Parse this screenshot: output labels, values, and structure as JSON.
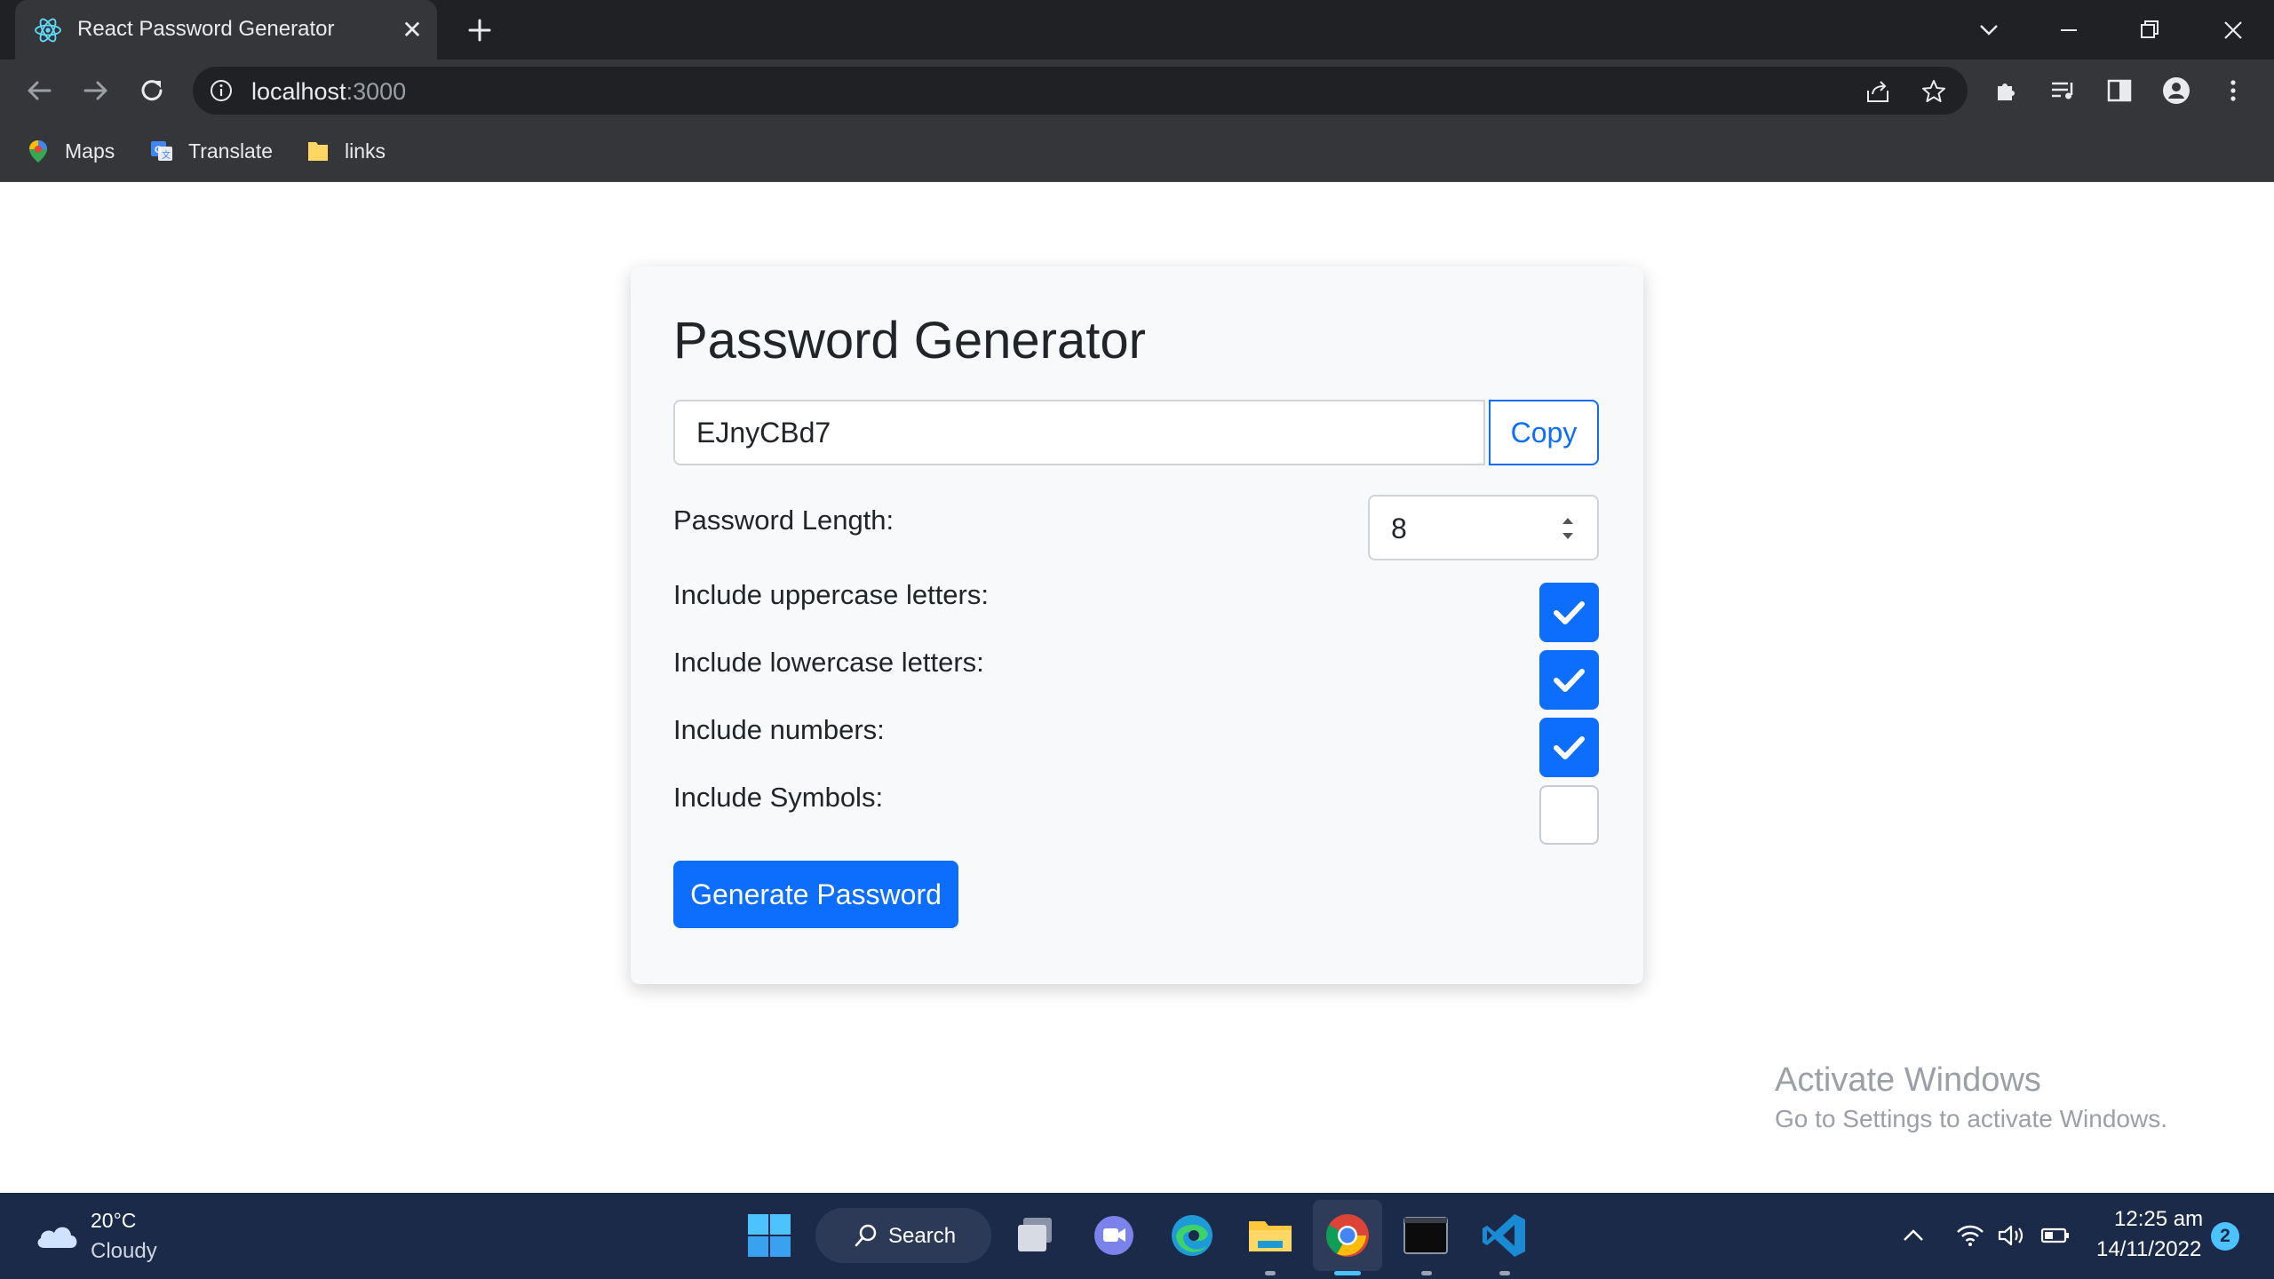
{
  "browser": {
    "tab": {
      "title": "React Password Generator",
      "close_glyph": "✕"
    },
    "address": {
      "host": "localhost",
      "port": ":3000"
    },
    "bookmarks": [
      {
        "label": "Maps",
        "icon": "maps-icon"
      },
      {
        "label": "Translate",
        "icon": "translate-icon"
      },
      {
        "label": "links",
        "icon": "folder-icon"
      }
    ]
  },
  "app": {
    "title": "Password Generator",
    "password_value": "EJnyCBd7",
    "copy_label": "Copy",
    "length_label": "Password Length:",
    "length_value": "8",
    "options": [
      {
        "label": "Include uppercase letters:",
        "checked": true
      },
      {
        "label": "Include lowercase letters:",
        "checked": true
      },
      {
        "label": "Include numbers:",
        "checked": true
      },
      {
        "label": "Include Symbols:",
        "checked": false
      }
    ],
    "generate_label": "Generate Password"
  },
  "watermark": {
    "title": "Activate Windows",
    "subtitle": "Go to Settings to activate Windows."
  },
  "taskbar": {
    "weather_temp": "20°C",
    "weather_desc": "Cloudy",
    "search_label": "Search",
    "time": "12:25 am",
    "date": "14/11/2022",
    "notification_count": "2"
  },
  "colors": {
    "accent": "#0d6efd",
    "chrome_dark": "#202124",
    "chrome_mid": "#35363a",
    "taskbar": "#1c2a4a"
  }
}
